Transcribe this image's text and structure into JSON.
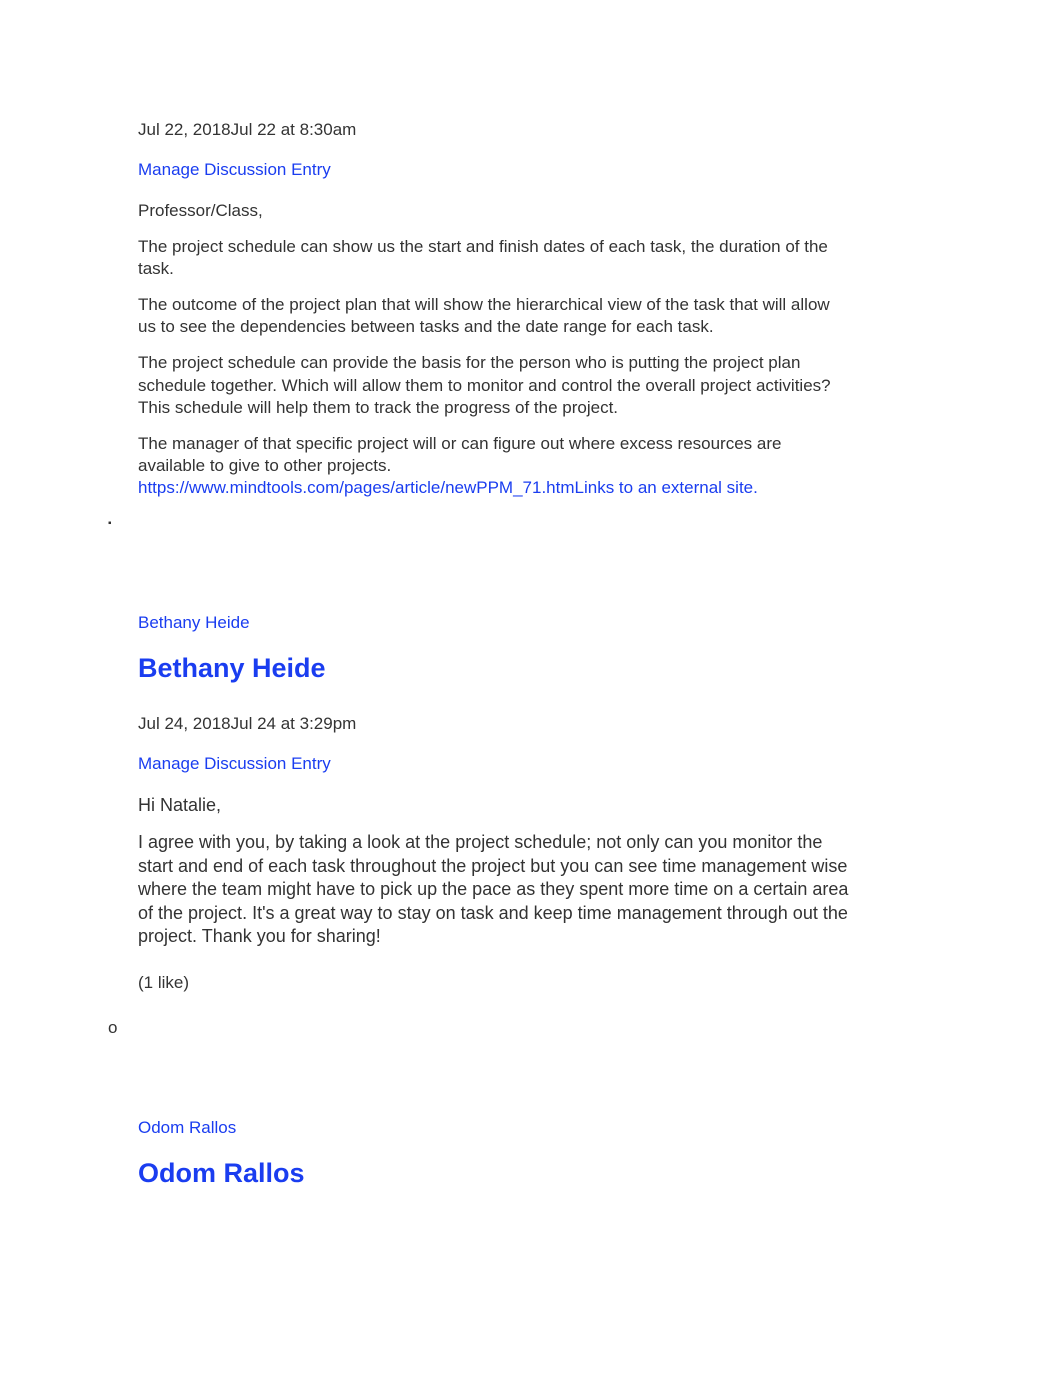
{
  "entries": [
    {
      "timestamp": "Jul 22, 2018Jul 22 at 8:30am",
      "manage_label": "Manage Discussion Entry",
      "paragraphs": [
        "Professor/Class,",
        "The project schedule can show us the start and finish dates of each task, the duration of the task.",
        "The outcome of the project plan that will show the hierarchical view of the task that will allow us to see the dependencies between tasks and the date range for each task.",
        "The project schedule can provide the basis for the person who is putting the project plan schedule together. Which will allow them to monitor and control the overall project activities? This schedule will help them to track the progress of the project.",
        "The manager of that specific project will or can figure out where excess resources are available to give to other projects."
      ],
      "link_text": "https://www.mindtools.com/pages/article/newPPM_71.htmLinks to an external site."
    },
    {
      "bullet": "dot",
      "author_link": "Bethany Heide",
      "author_heading": "Bethany Heide",
      "timestamp": "Jul 24, 2018Jul 24 at 3:29pm",
      "manage_label": "Manage Discussion Entry",
      "paragraphs": [
        "Hi Natalie,",
        "I agree with you, by taking a look at the project schedule; not only can you monitor the start and end of each task throughout the project but you can see time management wise where the team might have to pick up the pace as they spent more time on a certain area of the project. It's a great way to stay on task and keep time management through out the project. Thank you for sharing!"
      ],
      "likes": " (1 like)"
    },
    {
      "bullet": "o",
      "author_link": "Odom Rallos",
      "author_heading": "Odom Rallos"
    }
  ]
}
